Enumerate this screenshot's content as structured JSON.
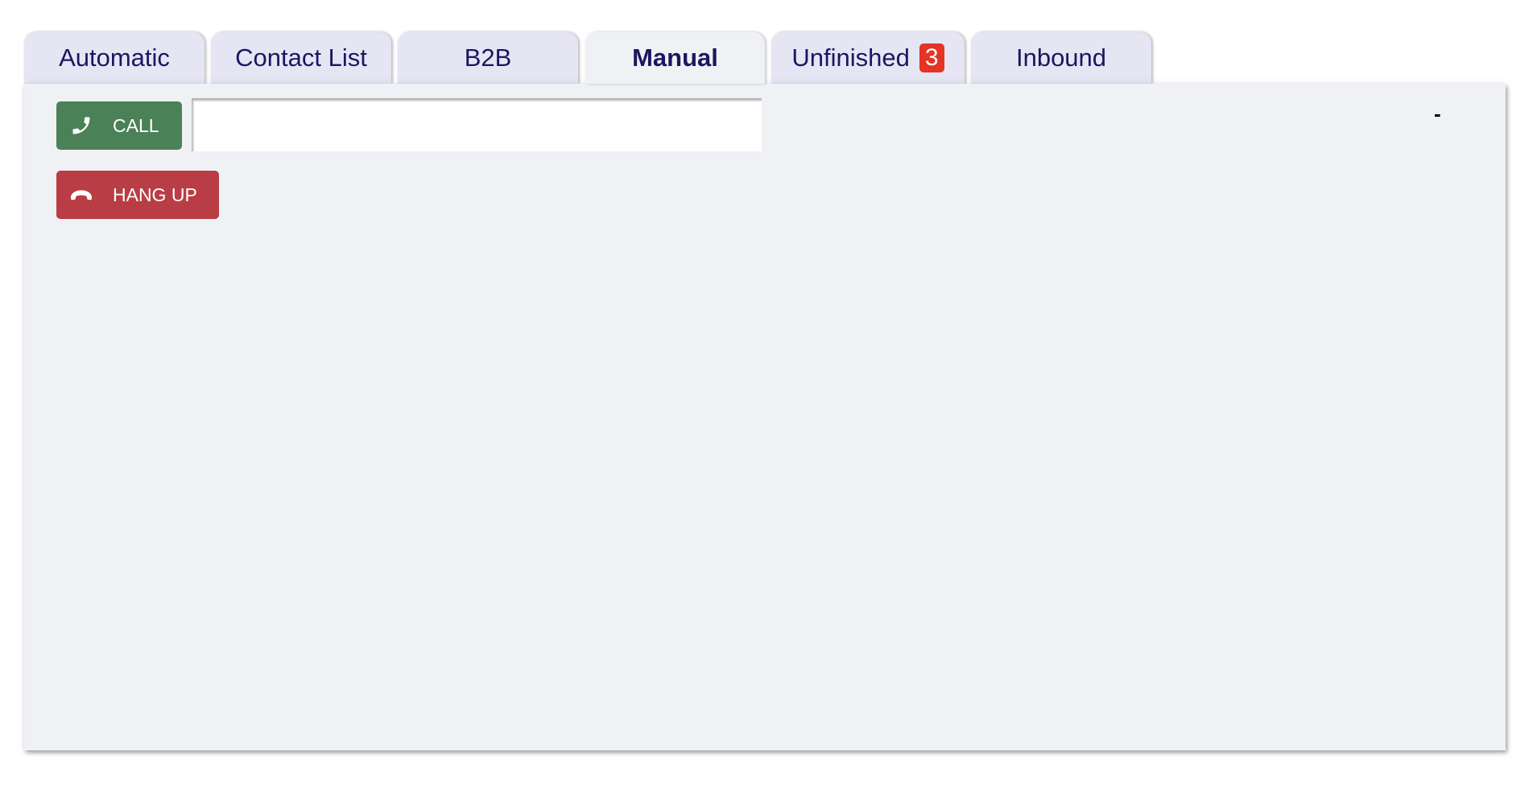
{
  "tabs": [
    {
      "label": "Automatic",
      "active": false
    },
    {
      "label": "Contact List",
      "active": false
    },
    {
      "label": "B2B",
      "active": false
    },
    {
      "label": "Manual",
      "active": true
    },
    {
      "label": "Unfinished",
      "active": false,
      "badge": "3"
    },
    {
      "label": "Inbound",
      "active": false
    }
  ],
  "colors": {
    "tab_bg": "#e6e5f4",
    "panel_bg": "#f0f1f5",
    "tab_text": "#1c1660",
    "call_green": "#4a8156",
    "hangup_red": "#b93d44",
    "badge_red": "#e53324"
  },
  "manual": {
    "call_label": "CALL",
    "call_icon": "phone-icon",
    "hangup_label": "HANG UP",
    "hangup_icon": "phone-hangup-icon",
    "number_value": "",
    "number_placeholder": "",
    "status_text": "-"
  }
}
